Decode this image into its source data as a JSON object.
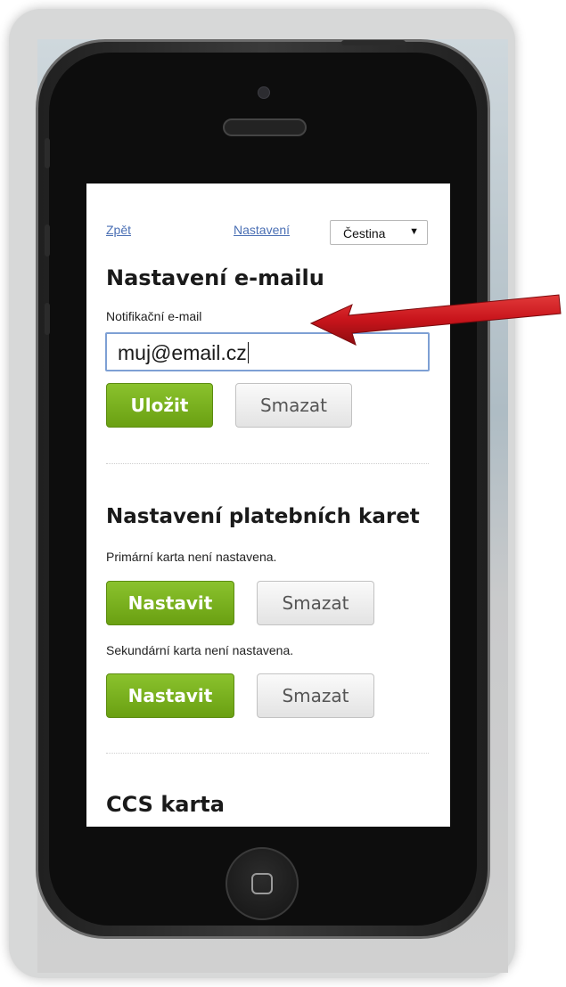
{
  "nav": {
    "back_label": "Zpět",
    "settings_label": "Nastavení",
    "language_selected": "Čestina"
  },
  "email_section": {
    "heading": "Nastavení e-mailu",
    "field_label": "Notifikační e-mail",
    "field_value": "muj@email.cz",
    "save_label": "Uložit",
    "delete_label": "Smazat"
  },
  "card_section": {
    "heading": "Nastavení platebních karet",
    "primary_status": "Primární karta není nastavena.",
    "primary_set_label": "Nastavit",
    "primary_delete_label": "Smazat",
    "secondary_status": "Sekundární karta není nastavena.",
    "secondary_set_label": "Nastavit",
    "secondary_delete_label": "Smazat"
  },
  "ccs_section": {
    "heading": "CCS karta"
  },
  "colors": {
    "accent_green": "#7ab51d",
    "link_blue": "#4a6fb4",
    "annotation_red": "#c8141b"
  },
  "icons": {
    "language_dropdown": "chevron-down-icon",
    "home_button": "home-square-icon"
  }
}
